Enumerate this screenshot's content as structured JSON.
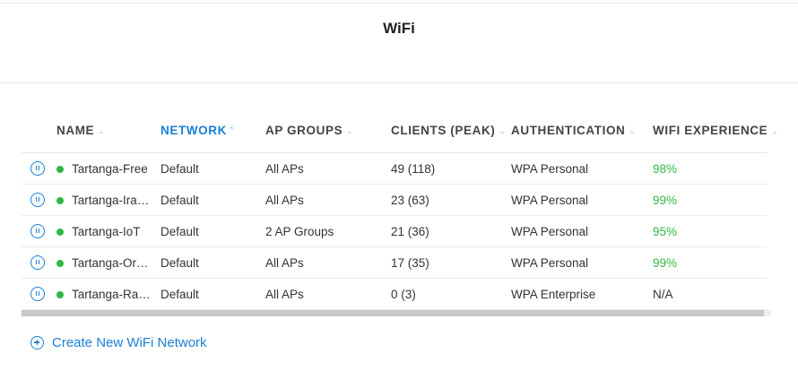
{
  "page": {
    "title": "WiFi"
  },
  "table": {
    "columns": [
      {
        "label": "NAME",
        "sort": "none"
      },
      {
        "label": "NETWORK",
        "sort": "ascending"
      },
      {
        "label": "AP GROUPS",
        "sort": "none"
      },
      {
        "label": "CLIENTS (PEAK)",
        "sort": "none"
      },
      {
        "label": "AUTHENTICATION",
        "sort": "none"
      },
      {
        "label": "WIFI EXPERIENCE",
        "sort": "none"
      }
    ],
    "rows": [
      {
        "name": "Tartanga-Free",
        "network": "Default",
        "ap_groups": "All APs",
        "clients": "49 (118)",
        "authentication": "WPA Personal",
        "experience": "98%"
      },
      {
        "name": "Tartanga-Irak…",
        "network": "Default",
        "ap_groups": "All APs",
        "clients": "23 (63)",
        "authentication": "WPA Personal",
        "experience": "99%"
      },
      {
        "name": "Tartanga-IoT",
        "network": "Default",
        "ap_groups": "2 AP Groups",
        "clients": "21 (36)",
        "authentication": "WPA Personal",
        "experience": "95%"
      },
      {
        "name": "Tartanga-Ord…",
        "network": "Default",
        "ap_groups": "All APs",
        "clients": "17 (35)",
        "authentication": "WPA Personal",
        "experience": "99%"
      },
      {
        "name": "Tartanga-Ra…",
        "network": "Default",
        "ap_groups": "All APs",
        "clients": "0 (3)",
        "authentication": "WPA Enterprise",
        "experience": "N/A"
      }
    ]
  },
  "create_button": {
    "label": "Create New WiFi Network"
  },
  "colors": {
    "accent": "#1a7fd6",
    "status_online": "#2fb844",
    "experience_good": "#2fb844"
  },
  "icons": {
    "row_action": "pause-circle-icon",
    "status": "status-dot-icon",
    "create": "plus-circle-icon",
    "sort_indicator": "caret-icon"
  }
}
